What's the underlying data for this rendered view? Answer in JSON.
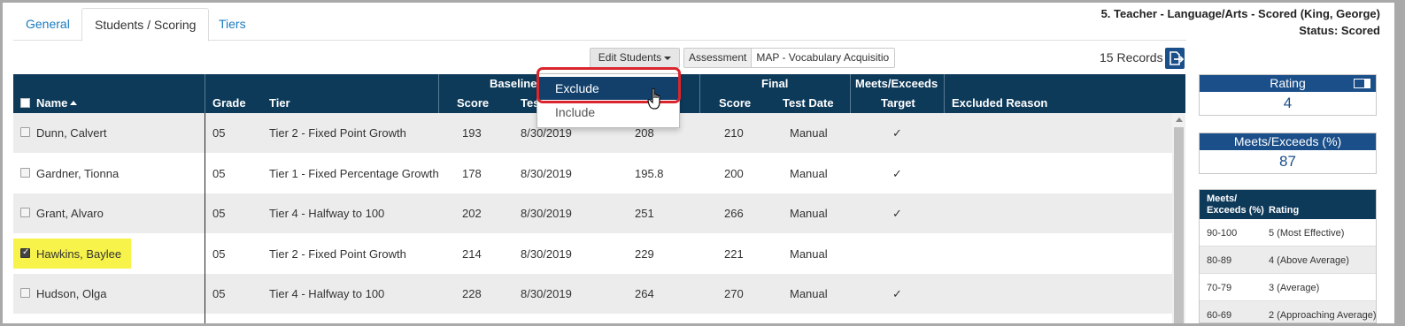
{
  "tabs": [
    {
      "label": "General",
      "active": false
    },
    {
      "label": "Students / Scoring",
      "active": true
    },
    {
      "label": "Tiers",
      "active": false
    }
  ],
  "header": {
    "title": "5. Teacher - Language/Arts - Scored (King, George)",
    "status": "Status: Scored"
  },
  "toolbar": {
    "edit_students_label": "Edit Students",
    "assessment_label": "Assessment",
    "assessment_value": "MAP - Vocabulary Acquisitio",
    "records_label": "15 Records",
    "export_icon": "export-icon"
  },
  "dropdown": {
    "items": [
      "Exclude",
      "Include"
    ]
  },
  "table": {
    "group_headers": {
      "baseline": "Baseline",
      "final": "Final",
      "meets_exceeds": "Meets/Exceeds"
    },
    "columns": {
      "name": "Name",
      "grade": "Grade",
      "tier": "Tier",
      "score": "Score",
      "test_date_partial": "Test",
      "final_score": "Score",
      "final_test_date": "Test Date",
      "target": "Target",
      "excluded_reason": "Excluded Reason"
    },
    "rows": [
      {
        "name": "Dunn, Calvert",
        "grade": "05",
        "tier": "Tier 2 - Fixed Point Growth",
        "baseline_score": "193",
        "baseline_date": "8/30/2019",
        "target_score": "208",
        "final_score": "210",
        "final_date": "Manual",
        "met": "✓",
        "checked": false
      },
      {
        "name": "Gardner, Tionna",
        "grade": "05",
        "tier": "Tier 1 - Fixed Percentage Growth",
        "baseline_score": "178",
        "baseline_date": "8/30/2019",
        "target_score": "195.8",
        "final_score": "200",
        "final_date": "Manual",
        "met": "✓",
        "checked": false
      },
      {
        "name": "Grant, Alvaro",
        "grade": "05",
        "tier": "Tier 4 - Halfway to 100",
        "baseline_score": "202",
        "baseline_date": "8/30/2019",
        "target_score": "251",
        "final_score": "266",
        "final_date": "Manual",
        "met": "✓",
        "checked": false
      },
      {
        "name": "Hawkins, Baylee",
        "grade": "05",
        "tier": "Tier 2 - Fixed Point Growth",
        "baseline_score": "214",
        "baseline_date": "8/30/2019",
        "target_score": "229",
        "final_score": "221",
        "final_date": "Manual",
        "met": "",
        "checked": true
      },
      {
        "name": "Hudson, Olga",
        "grade": "05",
        "tier": "Tier 4 - Halfway to 100",
        "baseline_score": "228",
        "baseline_date": "8/30/2019",
        "target_score": "264",
        "final_score": "270",
        "final_date": "Manual",
        "met": "✓",
        "checked": false
      }
    ]
  },
  "rating_panel": {
    "title": "Rating",
    "value": "4"
  },
  "meets_panel": {
    "title": "Meets/Exceeds (%)",
    "value": "87"
  },
  "legend": {
    "col1": [
      "Meets/",
      "Exceeds (%)"
    ],
    "col2": "Rating",
    "rows": [
      {
        "range": "90-100",
        "rating": "5 (Most Effective)"
      },
      {
        "range": "80-89",
        "rating": "4 (Above Average)"
      },
      {
        "range": "70-79",
        "rating": "3 (Average)"
      },
      {
        "range": "60-69",
        "rating": "2 (Approaching Average)"
      }
    ]
  },
  "colors": {
    "header_navy": "#0e3a5a",
    "accent_blue": "#1b4f8a",
    "highlight_yellow": "#f7f34a",
    "annotation_red": "#d9262d"
  }
}
